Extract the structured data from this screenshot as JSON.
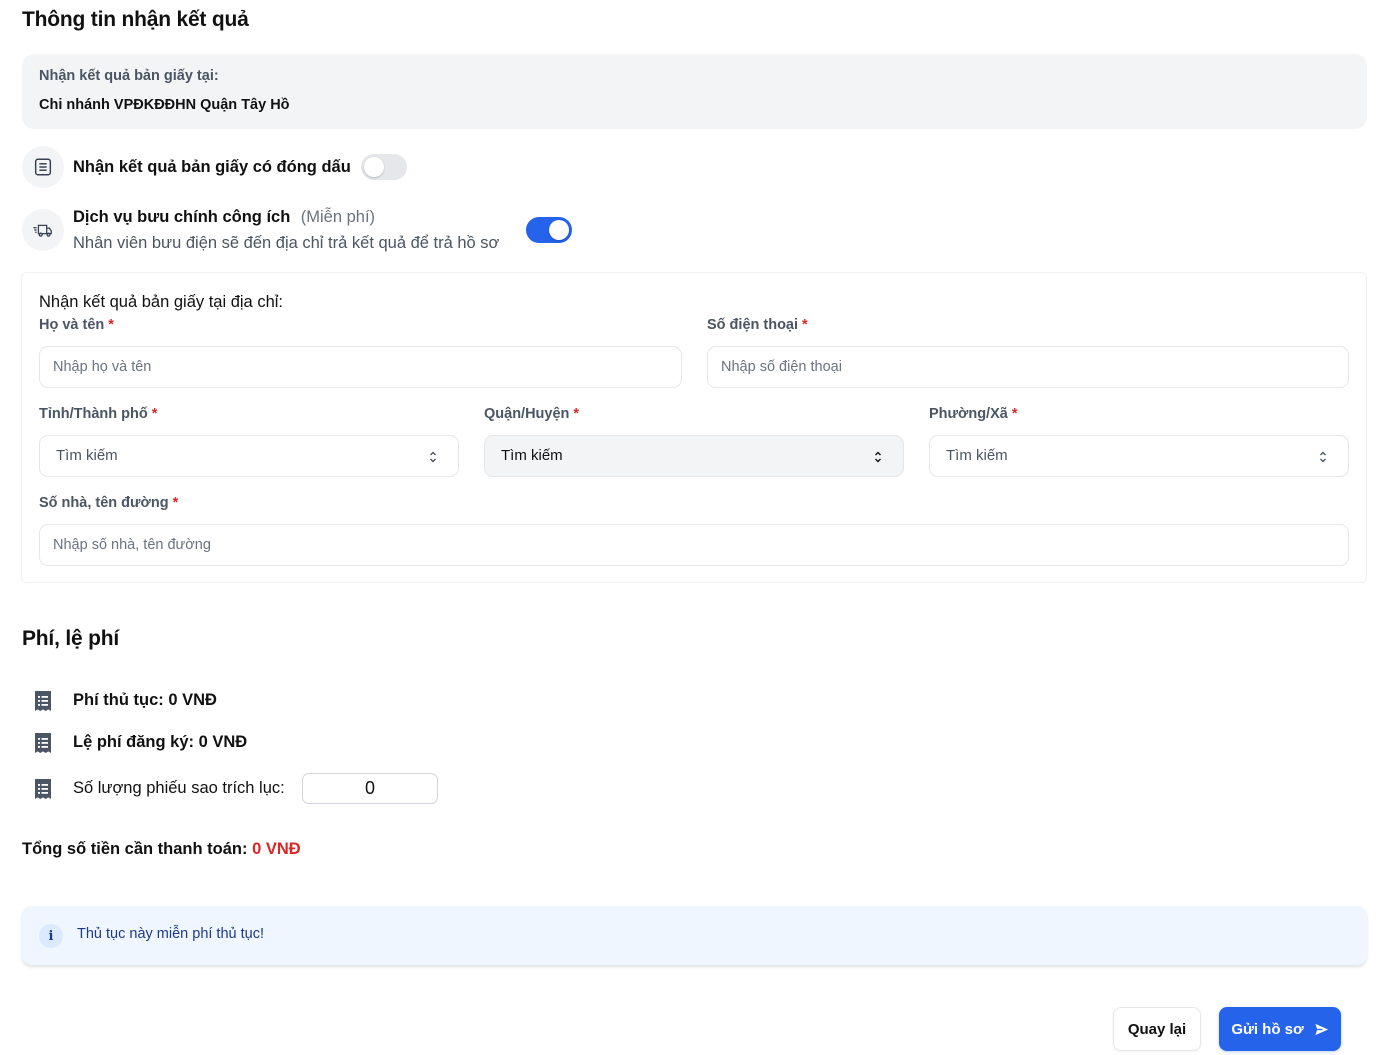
{
  "result_section": {
    "title": "Thông tin nhận kết quả",
    "pickup_label": "Nhận kết quả bản giấy tại:",
    "pickup_value": "Chi nhánh VPĐKĐĐHN Quận Tây Hồ"
  },
  "stamped_option": {
    "label": "Nhận kết quả bản giấy có đóng dấu",
    "enabled": false,
    "icon": "document-list-icon"
  },
  "postal_option": {
    "label": "Dịch vụ bưu chính công ích",
    "sub_label": "(Miễn phí)",
    "description": "Nhân viên bưu điện sẽ đến địa chỉ trả kết quả để trả hồ sơ",
    "enabled": true,
    "icon": "delivery-truck-icon"
  },
  "address_form": {
    "heading": "Nhận kết quả bản giấy tại địa chỉ:",
    "required_mark": "*",
    "full_name": {
      "label": "Họ và tên",
      "placeholder": "Nhập họ và tên"
    },
    "phone": {
      "label": "Số điện thoại",
      "placeholder": "Nhập số điện thoại"
    },
    "province": {
      "label": "Tỉnh/Thành phố",
      "value": "Tìm kiếm"
    },
    "district": {
      "label": "Quận/Huyện",
      "value": "Tìm kiếm"
    },
    "ward": {
      "label": "Phường/Xã",
      "value": "Tìm kiếm"
    },
    "street": {
      "label": "Số nhà, tên đường",
      "placeholder": "Nhập số nhà, tên đường"
    }
  },
  "fees_section": {
    "title": "Phí, lệ phí",
    "procedure_fee": "Phí thủ tục: 0 VNĐ",
    "registration_fee": "Lệ phí đăng ký: 0 VNĐ",
    "copy_count_label": "Số lượng phiếu sao trích lục:",
    "copy_count_value": "0",
    "total_label": "Tổng số tiền cần thanh toán:",
    "total_amount": "0 VNĐ"
  },
  "info_notice": {
    "icon_glyph": "i",
    "text": "Thủ tục này miễn phí thủ tục!"
  },
  "actions": {
    "back_label": "Quay lại",
    "submit_label": "Gửi hồ sơ"
  },
  "colors": {
    "primary": "#2563eb",
    "danger": "#dc2626",
    "info_bg": "#eff6ff",
    "muted_bg": "#f3f4f6"
  }
}
